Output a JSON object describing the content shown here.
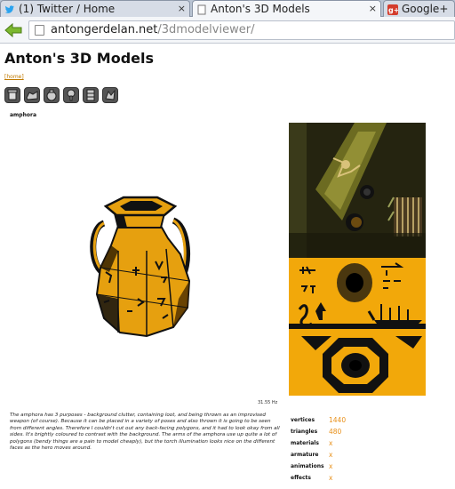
{
  "browser": {
    "tabs": [
      {
        "title": "(1) Twitter / Home",
        "icon": "twitter-icon",
        "close": "×"
      },
      {
        "title": "Anton's 3D Models",
        "icon": "page-icon",
        "close": "×"
      },
      {
        "title": "Google+",
        "icon": "google-plus-icon",
        "close": ""
      }
    ],
    "url_domain": "antongerdelan.net",
    "url_path": "/3dmodelviewer/"
  },
  "page": {
    "title": "Anton's 3D Models",
    "home_link": "[home]",
    "model_icons": [
      "model-icon-1",
      "model-icon-2",
      "model-icon-3",
      "model-icon-4",
      "model-icon-5",
      "model-icon-6"
    ],
    "model_name": "amphora",
    "fps": "31.55 Hz",
    "description": "The amphora has 3 purposes - background clutter, containing loot, and being thrown as an improvised weapon (of course). Because it can be placed in a variety of poses and also thrown it is going to be seen from different angles. Therefore I couldn't cut out any back-facing polygons, and it had to look okay from all sides. It's brightly coloured to contrast with the background. The arms of the amphora use up quite a lot of polygons (bendy things are a pain to model cheaply), but the torch illumination looks nice on the different faces as the hero moves around.",
    "stats": [
      {
        "label": "vertices",
        "value": "1440"
      },
      {
        "label": "triangles",
        "value": "480"
      },
      {
        "label": "materials",
        "value": "x"
      },
      {
        "label": "armature",
        "value": "x"
      },
      {
        "label": "animations",
        "value": "x"
      },
      {
        "label": "effects",
        "value": "x"
      }
    ]
  },
  "colors": {
    "accent": "#e8901a",
    "amphora_yellow": "#e6a00f",
    "tab_bar": "#b9c4d3"
  }
}
